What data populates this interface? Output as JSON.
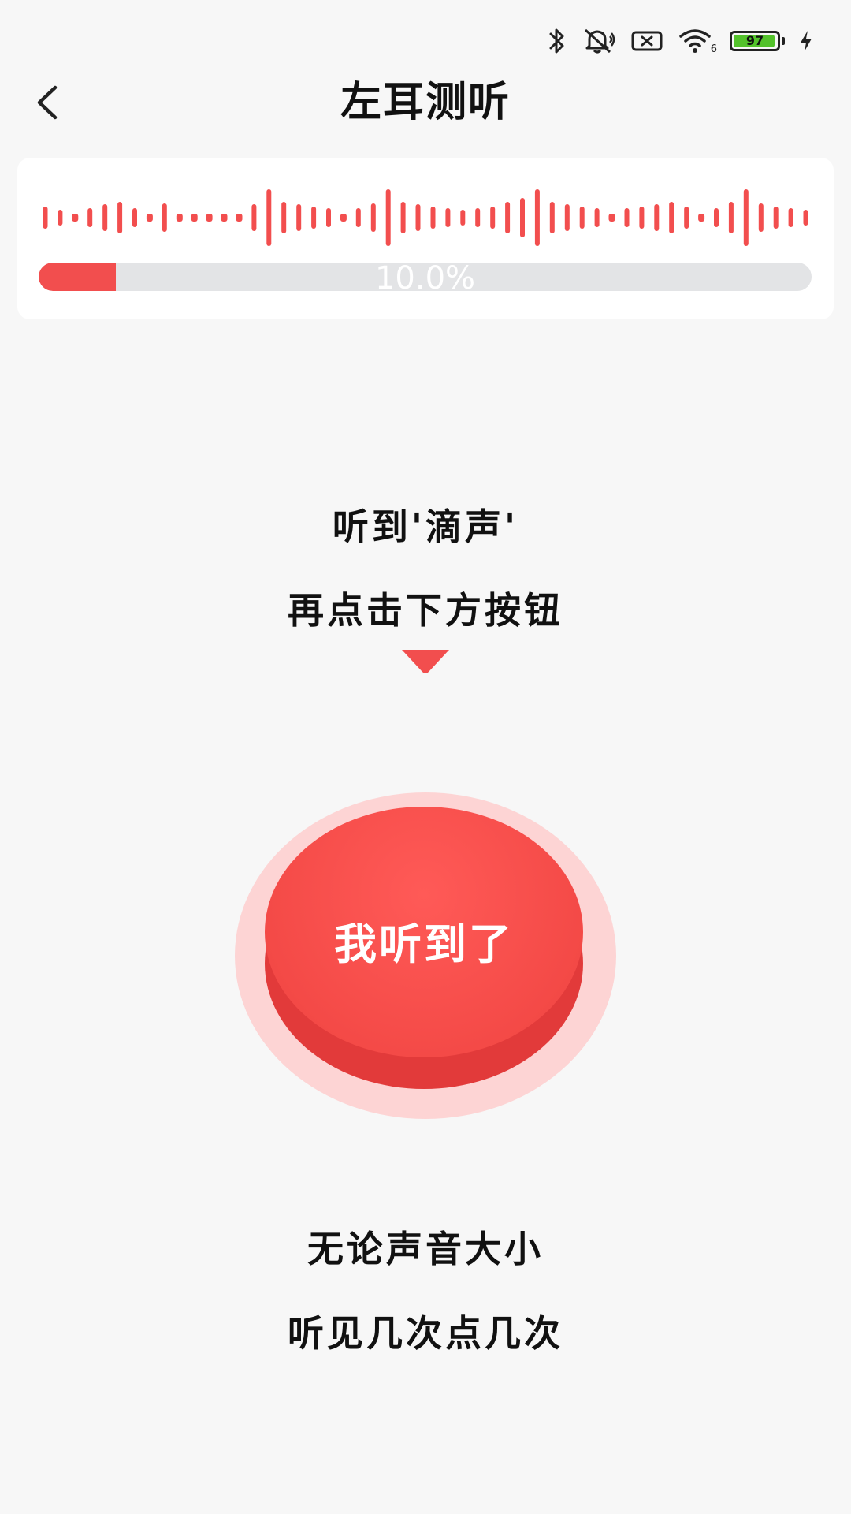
{
  "status_bar": {
    "icons": [
      "bluetooth-icon",
      "mute-icon",
      "sim-off-icon",
      "wifi-icon",
      "battery-icon",
      "charging-icon"
    ],
    "wifi_sub": "6",
    "battery_level": 97,
    "battery_text": "97",
    "battery_color": "#53c22b"
  },
  "header": {
    "title": "左耳测听",
    "back_icon": "chevron-left-icon"
  },
  "progress": {
    "fraction": 0.1,
    "text": "10.0%",
    "fill_color": "#f24e4e",
    "track_color": "#e3e4e6"
  },
  "instructions": {
    "line1": "听到'滴声'",
    "line2": "再点击下方按钮"
  },
  "button": {
    "label": "我听到了",
    "color": "#f44a47",
    "halo_color": "#fdd4d4"
  },
  "tips": {
    "line1": "无论声音大小",
    "line2": "听见几次点几次"
  },
  "colors": {
    "accent": "#f24e4e",
    "background": "#f7f7f7"
  }
}
